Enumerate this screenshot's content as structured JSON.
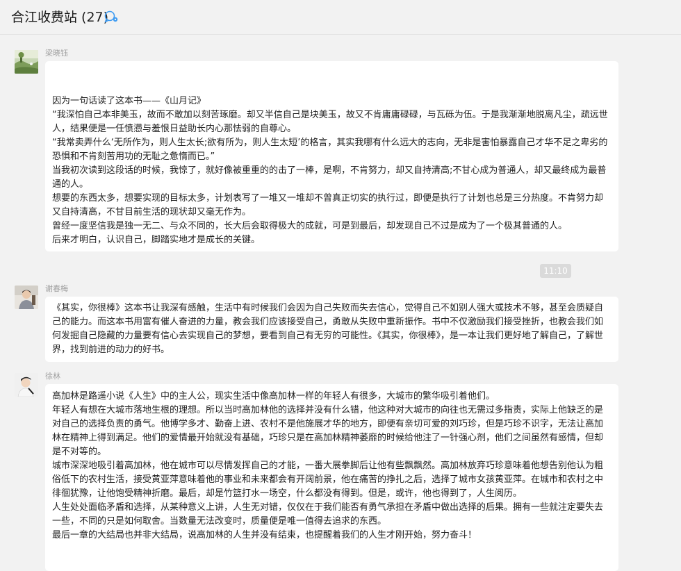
{
  "chat": {
    "title": "合江收费站 (27)",
    "header_icon": "group-chat-icon",
    "accent_color": "#3d9bf2"
  },
  "messages": [
    {
      "sender": "梁晓钰",
      "avatar_icon": "landscape-avatar-icon",
      "lines": [
        "",
        "",
        "因为一句话读了这本书——《山月记》",
        "“我深怕自己本非美玉，故而不敢加以刻苦琢磨。却又半信自己是块美玉，故又不肯庸庸碌碌，与瓦砾为伍。于是我渐渐地脱离凡尘，疏远世人，结果便是一任愤懑与羞恨日益助长内心那怯弱的自尊心。",
        "“我常卖弄什么‘无所作为，则人生太长;欲有所为，则人生太短’的格言，其实我哪有什么远大的志向，无非是害怕暴露自己才华不足之卑劣的恐惧和不肯刻苦用功的无耻之惫惰而已。”",
        "当我初次读到这段话的时候，我惊了，就好像被重重的的击了一棒，是啊，不肯努力，却又自持清高;不甘心成为普通人，却又最终成为最普通的人。",
        "想要的东西太多，想要实现的目标太多，计划表写了一堆又一堆却不曾真正切实的执行过，即便是执行了计划也总是三分热度。不肯努力却又自持清高，不甘目前生活的现状却又毫无作为。",
        "曾经一度坚信我是独一无二、与众不同的，长大后会取得极大的成就，可是到最后，却发现自己不过是成为了一个极其普通的人。",
        "后来才明白，认识自己，脚踏实地才是成长的关键。"
      ]
    },
    {
      "sender": "谢春梅",
      "avatar_icon": "person-avatar-icon",
      "lines": [
        "《其实，你很棒》这本书让我深有感触，生活中有时候我们会因为自己失败而失去信心，觉得自己不如别人强大或技术不够，甚至会质疑自己的能力。而这本书用富有催人奋进的力量，教会我们应该接受自己，勇敢从失败中重新振作。书中不仅激励我们接受挫折，也教会我们如何发掘自己隐藏的力量要有信心去实现自己的梦想，要看到自己有无穷的可能性。《其实，你很棒》，是一本让我们更好地了解自己，了解世界，找到前进的动力的好书。"
      ]
    },
    {
      "sender": "徐林",
      "avatar_icon": "person-avatar-icon",
      "lines": [
        "高加林是路遥小说《人生》中的主人公，现实生活中像高加林一样的年轻人有很多，大城市的繁华吸引着他们。",
        "年轻人有想在大城市落地生根的理想。所以当时高加林他的选择并没有什么错，他这种对大城市的向往也无需过多指责，实际上他缺乏的是对自己的选择负责的勇气。他博学多才、勤奋上进、农村不是他施展才华的地方，即便有亲切可爱的刘巧珍，但是巧珍不识字，无法让高加林在精神上得到满足。他们的爱情最开始就没有基础，巧珍只是在高加林精神萎靡的时候给他注了一针强心剂，他们之间虽然有感情，但却是不对等的。",
        "城市深深地吸引着高加林，他在城市可以尽情发挥自己的才能，一番大展拳脚后让他有些飘飘然。高加林放弃巧珍意味着他想告别他认为粗俗低下的农村生活，接受黄亚萍意味着他的事业和未来都会有开阔前景，他在痛苦的挣扎之后，选择了城市女孩黄亚萍。在城市和农村之中徘徊犹豫，让他饱受精神折磨。最后，却是竹篮打水一场空，什么都没有得到。但是，或许，他也得到了，人生阅历。",
        "人生处处面临矛盾和选择，从某种意义上讲，人生无对错，仅仅在于我们能否有勇气承担在矛盾中做出选择的后果。拥有一些就注定要失去一些，不同的只是如何取舍。当数量无法改变时，质量便是唯一值得去追求的东西。",
        "最后一章的大结局也并非大结局，说高加林的人生并没有结束，也提醒着我们的人生才刚开始，努力奋斗！"
      ]
    }
  ],
  "timestamp": "11:10"
}
